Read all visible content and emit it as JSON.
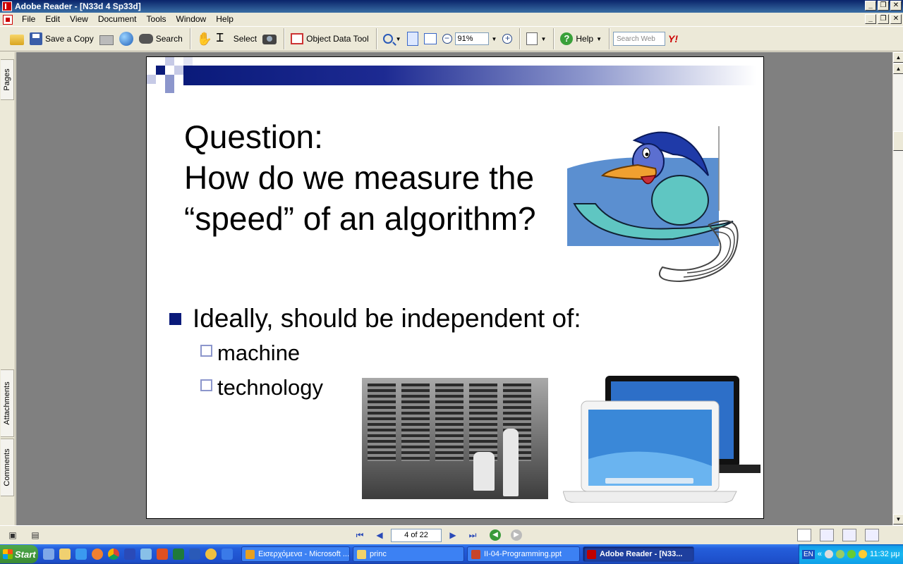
{
  "window": {
    "title": "Adobe Reader - [N33d 4 Sp33d]"
  },
  "menu": [
    "File",
    "Edit",
    "View",
    "Document",
    "Tools",
    "Window",
    "Help"
  ],
  "toolbar": {
    "save_copy": "Save a Copy",
    "search": "Search",
    "select": "Select",
    "object_data_tool": "Object Data Tool",
    "zoom_value": "91%",
    "help": "Help",
    "search_web_placeholder": "Search Web",
    "yahoo": "Y!"
  },
  "side_tabs": [
    "Pages",
    "Attachments",
    "Comments"
  ],
  "slide": {
    "title_line1": "Question:",
    "title_line2": "How do we measure the",
    "title_line3": "“speed” of an algorithm?",
    "bullet": "Ideally, should be independent of:",
    "sub_bullets": [
      "machine",
      "technology"
    ]
  },
  "statusbar": {
    "page_indicator": "4 of 22"
  },
  "taskbar": {
    "start": "Start",
    "tasks": [
      {
        "label": "Εισερχόμενα - Microsoft ...",
        "color": "#e8a020"
      },
      {
        "label": "princ",
        "color": "#f1d36a"
      },
      {
        "label": "II-04-Programming.ppt",
        "color": "#c8452a"
      },
      {
        "label": "Adobe Reader - [N33...",
        "color": "#c00000"
      }
    ],
    "language": "EN",
    "clock": "11:32 μμ"
  }
}
